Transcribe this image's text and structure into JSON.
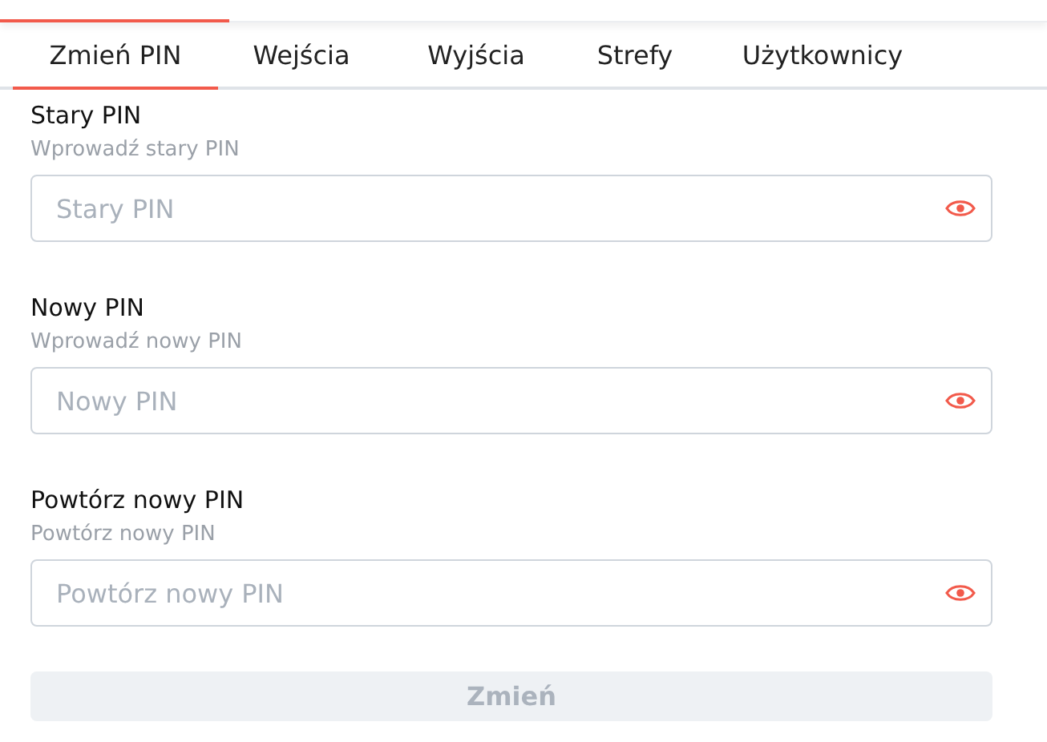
{
  "tabs": [
    {
      "label": "Zmień PIN",
      "selected": true
    },
    {
      "label": "Wejścia",
      "selected": false
    },
    {
      "label": "Wyjścia",
      "selected": false
    },
    {
      "label": "Strefy",
      "selected": false
    },
    {
      "label": "Użytkownicy",
      "selected": false
    }
  ],
  "fields": [
    {
      "label": "Stary PIN",
      "hint": "Wprowadź stary PIN",
      "placeholder": "Stary PIN"
    },
    {
      "label": "Nowy PIN",
      "hint": "Wprowadź nowy PIN",
      "placeholder": "Nowy PIN"
    },
    {
      "label": "Powtórz nowy PIN",
      "hint": "Powtórz nowy PIN",
      "placeholder": "Powtórz nowy PIN"
    }
  ],
  "submit": {
    "label": "Zmień",
    "disabled": true
  }
}
